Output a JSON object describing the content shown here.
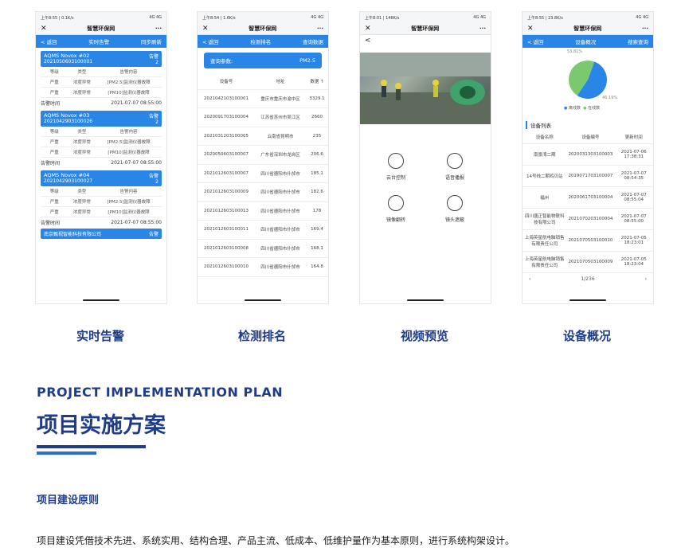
{
  "phones": {
    "alerts": {
      "status_left": "上午8:55 | 0.1K/s",
      "status_right": "4G 4G",
      "title": "智慧环保网",
      "more": "···",
      "back": "< 返回",
      "tab": "实时告警",
      "action": "同步刷新",
      "cards": [
        {
          "name": "AQMS Novox #02",
          "code": "2021050603100001",
          "badge": "告警",
          "count": "2",
          "headers": [
            "等级",
            "类型",
            "告警内容"
          ],
          "rows": [
            [
              "严重",
              "浓度异常",
              "[PM2.5]监测仪器故障"
            ],
            [
              "严重",
              "浓度异常",
              "[PM10]监测仪器故障"
            ]
          ],
          "time_label": "告警时间",
          "time": "2021-07-07 08:55:00"
        },
        {
          "name": "AQMS Novox #03",
          "code": "2021042903100026",
          "badge": "告警",
          "count": "2",
          "headers": [
            "等级",
            "类型",
            "告警内容"
          ],
          "rows": [
            [
              "严重",
              "浓度异常",
              "[PM2.5]监测仪器故障"
            ],
            [
              "严重",
              "浓度异常",
              "[PM10]监测仪器故障"
            ]
          ],
          "time_label": "告警时间",
          "time": "2021-07-07 08:55:00"
        },
        {
          "name": "AQMS Novox #04",
          "code": "2021042903100027",
          "badge": "告警",
          "count": "2",
          "headers": [
            "等级",
            "类型",
            "告警内容"
          ],
          "rows": [
            [
              "严重",
              "浓度异常",
              "[PM2.5]监测仪器故障"
            ],
            [
              "严重",
              "浓度异常",
              "[PM10]监测仪器故障"
            ]
          ],
          "time_label": "告警时间",
          "time": "2021-07-07 08:55:00"
        }
      ],
      "last_card": {
        "name": "南京甄视智能科技有限公司",
        "badge": "告警"
      }
    },
    "ranking": {
      "status_left": "上午8:54 | 1.6K/s",
      "title": "智慧环保网",
      "more": "···",
      "back": "< 返回",
      "tab": "检测排名",
      "action": "查询数据",
      "query_label": "查询参数:",
      "query_value": "PM2.5",
      "headers": [
        "设备号",
        "地址",
        "数据 ↑"
      ],
      "rows": [
        [
          "2021042103100001",
          "重庆市重庆市渝中区",
          "3329.1"
        ],
        [
          "2020091703100004",
          "江苏省苏州市吴江区",
          "2660"
        ],
        [
          "2021031203100005",
          "云南省昆明市",
          "235"
        ],
        [
          "2020050603100007",
          "广东省深圳市龙岗区",
          "206.6"
        ],
        [
          "2021012603100007",
          "四川省德阳市什邡市",
          "185.1"
        ],
        [
          "2021012603100009",
          "四川省德阳市什邡市",
          "182.6"
        ],
        [
          "2021012603100013",
          "四川省德阳市什邡市",
          "178"
        ],
        [
          "2021012603100011",
          "四川省德阳市什邡市",
          "169.4"
        ],
        [
          "2021012603100008",
          "四川省德阳市什邡市",
          "168.1"
        ],
        [
          "2021012603100010",
          "四川省德阳市什邡市",
          "164.8"
        ]
      ]
    },
    "video": {
      "status_left": "上午8:01 | 146K/s",
      "title": "智慧环保网",
      "back": "<",
      "more": "···",
      "controls": [
        "云台控制",
        "语音播报",
        "镜像翻转",
        "镜头遮蔽"
      ]
    },
    "overview": {
      "status_left": "上午8:55 | 23.8K/s",
      "title": "智慧环保网",
      "more": "···",
      "back": "< 返回",
      "tab": "设备概况",
      "action": "搜索查询",
      "pie": {
        "offline_label": "53.81%",
        "online_label": "46.19%",
        "offline": 53.81,
        "online": 46.19,
        "legend_offline": "离线数",
        "legend_online": "在线数",
        "color_offline": "#2a86e6",
        "color_online": "#7bc96f"
      },
      "list_title": "设备列表",
      "headers": [
        "设备名称",
        "设备编号",
        "更新时间"
      ],
      "rows": [
        [
          "南景湾二期",
          "2020031303100003",
          "2021-07-06 17:38:31"
        ],
        [
          "14号线二期鸡贝站",
          "2019071703100007",
          "2021-07-07 08:54:35"
        ],
        [
          "福州",
          "2020061703100004",
          "2021-07-07 08:55:04"
        ],
        [
          "四川唐正智能物联科技有限公司",
          "2021070203100004",
          "2021-07-07 08:55:00"
        ],
        [
          "上海英星航电脑销售有限责任公司",
          "2021070503100010",
          "2021-07-05 18:23:01"
        ],
        [
          "上海英星航电脑销售有限责任公司",
          "2021070503100009",
          "2021-07-05 18:23:04"
        ]
      ],
      "pager": "1/236"
    }
  },
  "captions": [
    "实时告警",
    "检测排名",
    "视频预览",
    "设备概况"
  ],
  "section": {
    "en": "PROJECT IMPLEMENTATION PLAN",
    "cn": "项目实施方案",
    "subtitle": "项目建设原则",
    "paragraph": "项目建设凭借技术先进、系统实用、结构合理、产品主流、低成本、低维护量作为基本原则，进行系统构架设计。"
  },
  "colors": {
    "accent": "#1f3c88",
    "blue": "#2a86e6"
  }
}
